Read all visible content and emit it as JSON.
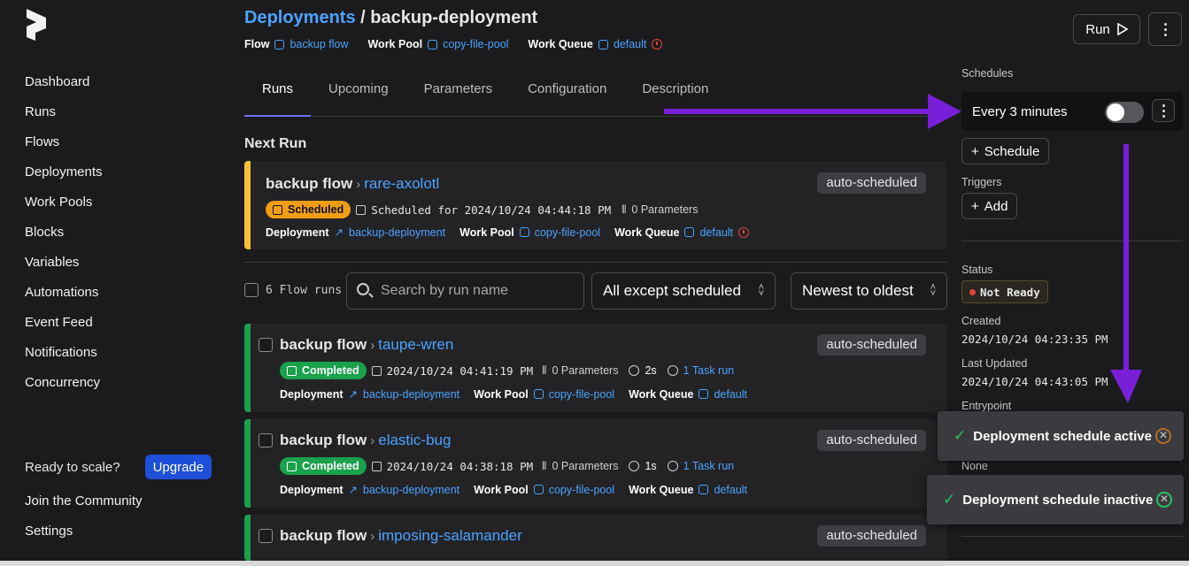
{
  "sidebar": {
    "items": [
      {
        "label": "Dashboard"
      },
      {
        "label": "Runs"
      },
      {
        "label": "Flows"
      },
      {
        "label": "Deployments"
      },
      {
        "label": "Work Pools"
      },
      {
        "label": "Blocks"
      },
      {
        "label": "Variables"
      },
      {
        "label": "Automations"
      },
      {
        "label": "Event Feed"
      },
      {
        "label": "Notifications"
      },
      {
        "label": "Concurrency"
      }
    ],
    "scale_text": "Ready to scale?",
    "upgrade_label": "Upgrade",
    "community": "Join the Community",
    "settings": "Settings"
  },
  "header": {
    "breadcrumb": "Deployments",
    "separator": "/",
    "title": "backup-deployment",
    "flow_label": "Flow",
    "flow_value": "backup flow",
    "pool_label": "Work Pool",
    "pool_value": "copy-file-pool",
    "queue_label": "Work Queue",
    "queue_value": "default",
    "run_label": "Run"
  },
  "tabs": [
    {
      "label": "Runs"
    },
    {
      "label": "Upcoming"
    },
    {
      "label": "Parameters"
    },
    {
      "label": "Configuration"
    },
    {
      "label": "Description"
    }
  ],
  "next_run": {
    "section_title": "Next Run",
    "flow": "backup flow",
    "run_name": "rare-axolotl",
    "tag": "auto-scheduled",
    "state": "Scheduled",
    "time": "Scheduled for 2024/10/24 04:44:18 PM",
    "params": "0 Parameters",
    "deployment_label": "Deployment",
    "deployment": "backup-deployment",
    "pool_label": "Work Pool",
    "pool": "copy-file-pool",
    "queue_label": "Work Queue",
    "queue": "default"
  },
  "filters": {
    "flow_runs": "6 Flow runs",
    "search_placeholder": "Search by run name",
    "state_filter": "All except scheduled",
    "sort": "Newest to oldest"
  },
  "runs": [
    {
      "flow": "backup flow",
      "name": "taupe-wren",
      "tag": "auto-scheduled",
      "state": "Completed",
      "time": "2024/10/24 04:41:19 PM",
      "params": "0 Parameters",
      "duration": "2s",
      "tasks": "1 Task run",
      "deployment_label": "Deployment",
      "deployment": "backup-deployment",
      "pool_label": "Work Pool",
      "pool": "copy-file-pool",
      "queue_label": "Work Queue",
      "queue": "default"
    },
    {
      "flow": "backup flow",
      "name": "elastic-bug",
      "tag": "auto-scheduled",
      "state": "Completed",
      "time": "2024/10/24 04:38:18 PM",
      "params": "0 Parameters",
      "duration": "1s",
      "tasks": "1 Task run",
      "deployment_label": "Deployment",
      "deployment": "backup-deployment",
      "pool_label": "Work Pool",
      "pool": "copy-file-pool",
      "queue_label": "Work Queue",
      "queue": "default"
    },
    {
      "flow": "backup flow",
      "name": "imposing-salamander",
      "tag": "auto-scheduled"
    }
  ],
  "right_panel": {
    "schedules_label": "Schedules",
    "schedule_text": "Every 3 minutes",
    "schedule_toggle_on": false,
    "add_schedule": "Schedule",
    "triggers_label": "Triggers",
    "add_trigger": "Add",
    "status_label": "Status",
    "status_value": "Not Ready",
    "created_label": "Created",
    "created_value": "2024/10/24 04:23:35 PM",
    "updated_label": "Last Updated",
    "updated_value": "2024/10/24 04:43:05 PM",
    "entrypoint_label": "Entrypoint",
    "none_value": "None"
  },
  "toasts": [
    {
      "message": "Deployment schedule active"
    },
    {
      "message": "Deployment schedule inactive"
    }
  ],
  "colors": {
    "accent": "#4aa3ff",
    "scheduled": "#f09d14",
    "completed": "#19a14b",
    "annotation_arrow": "#7a1fd8"
  }
}
